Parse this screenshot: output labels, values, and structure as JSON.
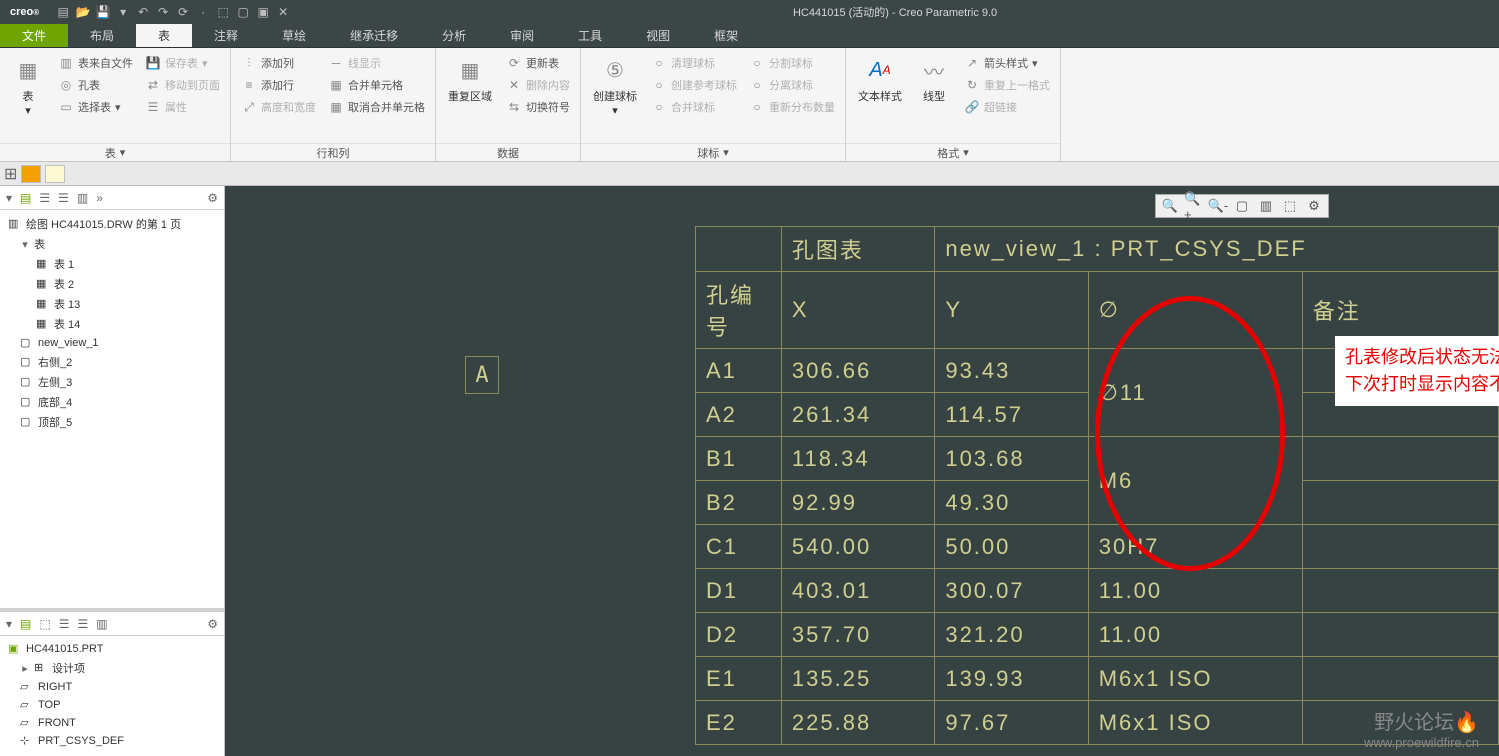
{
  "titlebar": {
    "logo": "creo",
    "title": "HC441015 (活动的) - Creo Parametric 9.0"
  },
  "tabs": [
    "文件",
    "布局",
    "表",
    "注释",
    "草绘",
    "继承迁移",
    "分析",
    "审阅",
    "工具",
    "视图",
    "框架"
  ],
  "ribbon": {
    "g_table": {
      "big": "表",
      "fromfile": "表来自文件",
      "holetable": "孔表",
      "selecttable": "选择表",
      "savetable": "保存表",
      "movepage": "移动到页面",
      "props": "属性",
      "label": "表"
    },
    "g_rowcol": {
      "addcol": "添加列",
      "addrow": "添加行",
      "hw": "高度和宽度",
      "linedisp": "线显示",
      "merge": "合并单元格",
      "unmerge": "取消合并单元格",
      "label": "行和列"
    },
    "g_data": {
      "repeat": "重复区域",
      "update": "更新表",
      "delcontent": "删除内容",
      "switch": "切换符号",
      "label": "数据"
    },
    "g_ball": {
      "create": "创建球标",
      "cleanup": "清理球标",
      "createref": "创建参考球标",
      "mergeball": "合并球标",
      "split": "分割球标",
      "detach": "分离球标",
      "redist": "重新分布数量",
      "label": "球标"
    },
    "g_format": {
      "textstyle": "文本样式",
      "linetype": "线型",
      "arrow": "箭头样式",
      "repeatfmt": "重复上一格式",
      "hyperlink": "超链接",
      "label": "格式"
    }
  },
  "tree1": {
    "root": "绘图 HC441015.DRW 的第 1 页",
    "t": "表",
    "t1": "表 1",
    "t2": "表 2",
    "t13": "表 13",
    "t14": "表 14",
    "nv": "new_view_1",
    "r2": "右侧_2",
    "l3": "左侧_3",
    "b4": "底部_4",
    "top5": "顶部_5"
  },
  "tree2": {
    "prt": "HC441015.PRT",
    "design": "设计项",
    "right": "RIGHT",
    "top": "TOP",
    "front": "FRONT",
    "csys": "PRT_CSYS_DEF"
  },
  "table": {
    "h1": "孔图表",
    "h2": "new_view_1 : PRT_CSYS_DEF",
    "hdr": [
      "孔编号",
      "X",
      "Y",
      "∅",
      "备注"
    ],
    "rows": [
      [
        "A1",
        "306.66",
        "93.43",
        "",
        ""
      ],
      [
        "A2",
        "261.34",
        "114.57",
        "∅11",
        ""
      ],
      [
        "B1",
        "118.34",
        "103.68",
        "",
        ""
      ],
      [
        "B2",
        "92.99",
        "49.30",
        "M6",
        ""
      ],
      [
        "C1",
        "540.00",
        "50.00",
        "30H7",
        ""
      ],
      [
        "D1",
        "403.01",
        "300.07",
        "11.00",
        ""
      ],
      [
        "D2",
        "357.70",
        "321.20",
        "11.00",
        ""
      ],
      [
        "E1",
        "135.25",
        "139.93",
        "M6x1 ISO",
        ""
      ],
      [
        "E2",
        "225.88",
        "97.67",
        "M6x1 ISO",
        ""
      ]
    ]
  },
  "label_a": "A",
  "annotation": {
    "l1": "孔表修改后状态无法保存，",
    "l2": "下次打时显示内容不对"
  },
  "watermark": {
    "l1": "野火论坛",
    "l2": "www.proewildfire.cn"
  }
}
